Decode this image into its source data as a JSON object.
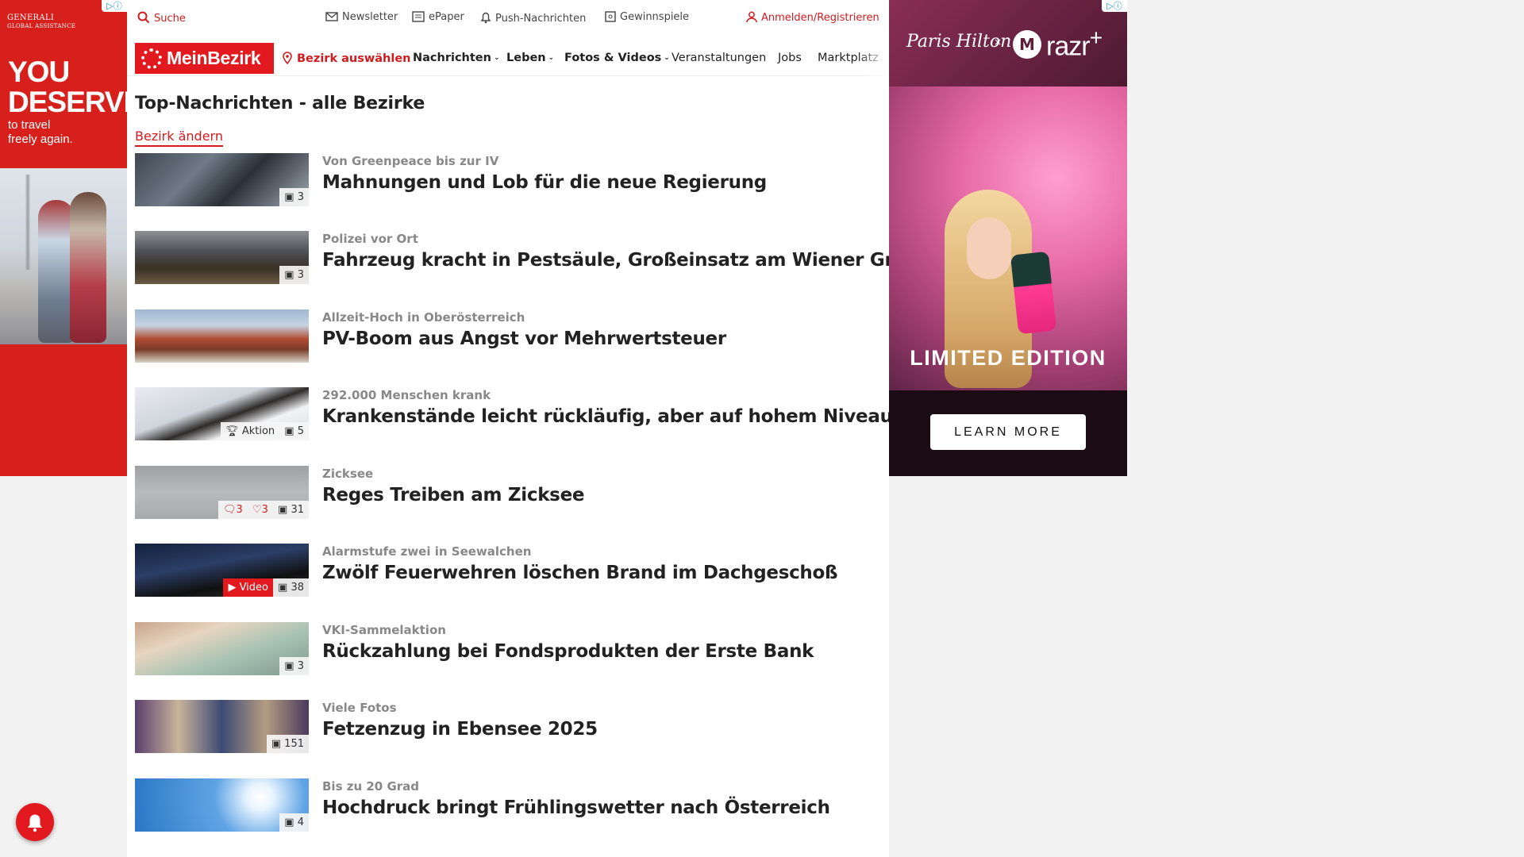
{
  "ad_left": {
    "brand": "GENERALI",
    "brand_sub": "GLOBAL ASSISTANCE",
    "headline_1": "YOU",
    "headline_2": "DESERVE",
    "sub_1": "to travel",
    "sub_2": "freely again."
  },
  "ad_right": {
    "signature": "Paris Hilton",
    "x": "×",
    "brand": "razr",
    "brand_plus": "+",
    "limited": "LIMITED EDITION",
    "cta": "LEARN MORE"
  },
  "util": {
    "search": "Suche",
    "newsletter": "Newsletter",
    "epaper": "ePaper",
    "push": "Push-Nachrichten",
    "games": "Gewinnspiele",
    "login": "Anmelden/Registrieren"
  },
  "nav": {
    "logo": "MeinBezirk",
    "district": "Bezirk auswählen",
    "news": "Nachrichten",
    "life": "Leben",
    "media": "Fotos & Videos",
    "events": "Veranstaltungen",
    "jobs": "Jobs",
    "market": "Marktplatz"
  },
  "page_title": "Top-Nachrichten - alle Bezirke",
  "change_district": "Bezirk ändern",
  "articles": [
    {
      "kicker": "Von Greenpeace bis zur IV",
      "headline": "Mahnungen und Lob für die neue Regierung",
      "images": "3"
    },
    {
      "kicker": "Polizei vor Ort",
      "headline": "Fahrzeug kracht in Pestsäule, Großeinsatz am Wiener Graben",
      "images": "3"
    },
    {
      "kicker": "Allzeit-Hoch in Oberösterreich",
      "headline": "PV-Boom aus Angst vor Mehrwertsteuer",
      "images": ""
    },
    {
      "kicker": "292.000 Menschen krank",
      "headline": "Krankenstände leicht rückläufig, aber auf hohem Niveau",
      "images": "5",
      "action": "Aktion"
    },
    {
      "kicker": "Zicksee",
      "headline": "Reges Treiben am Zicksee",
      "images": "31",
      "comments": "3",
      "likes": "3"
    },
    {
      "kicker": "Alarmstufe zwei in Seewalchen",
      "headline": "Zwölf Feuerwehren löschen Brand im Dachgeschoß",
      "images": "38",
      "video": "Video"
    },
    {
      "kicker": "VKI-Sammelaktion",
      "headline": "Rückzahlung bei Fondsprodukten der Erste Bank",
      "images": "3"
    },
    {
      "kicker": "Viele Fotos",
      "headline": "Fetzenzug in Ebensee 2025",
      "images": "151"
    },
    {
      "kicker": "Bis zu 20 Grad",
      "headline": "Hochdruck bringt Frühlingswetter nach Österreich",
      "images": "4"
    }
  ],
  "colors": {
    "brand_red": "#e2191e",
    "link_red": "#d01c1f",
    "kicker_gray": "#888888",
    "ad_left_bg": "#d7201c",
    "ad_right_bg": "#1b0c14"
  },
  "icons": [
    "search-icon",
    "mail-icon",
    "newspaper-icon",
    "bell-icon",
    "puzzle-icon",
    "user-icon",
    "location-pin-icon",
    "chevron-down-icon",
    "image-icon",
    "trophy-icon",
    "comment-icon",
    "heart-icon",
    "play-icon",
    "adchoices-icon"
  ]
}
